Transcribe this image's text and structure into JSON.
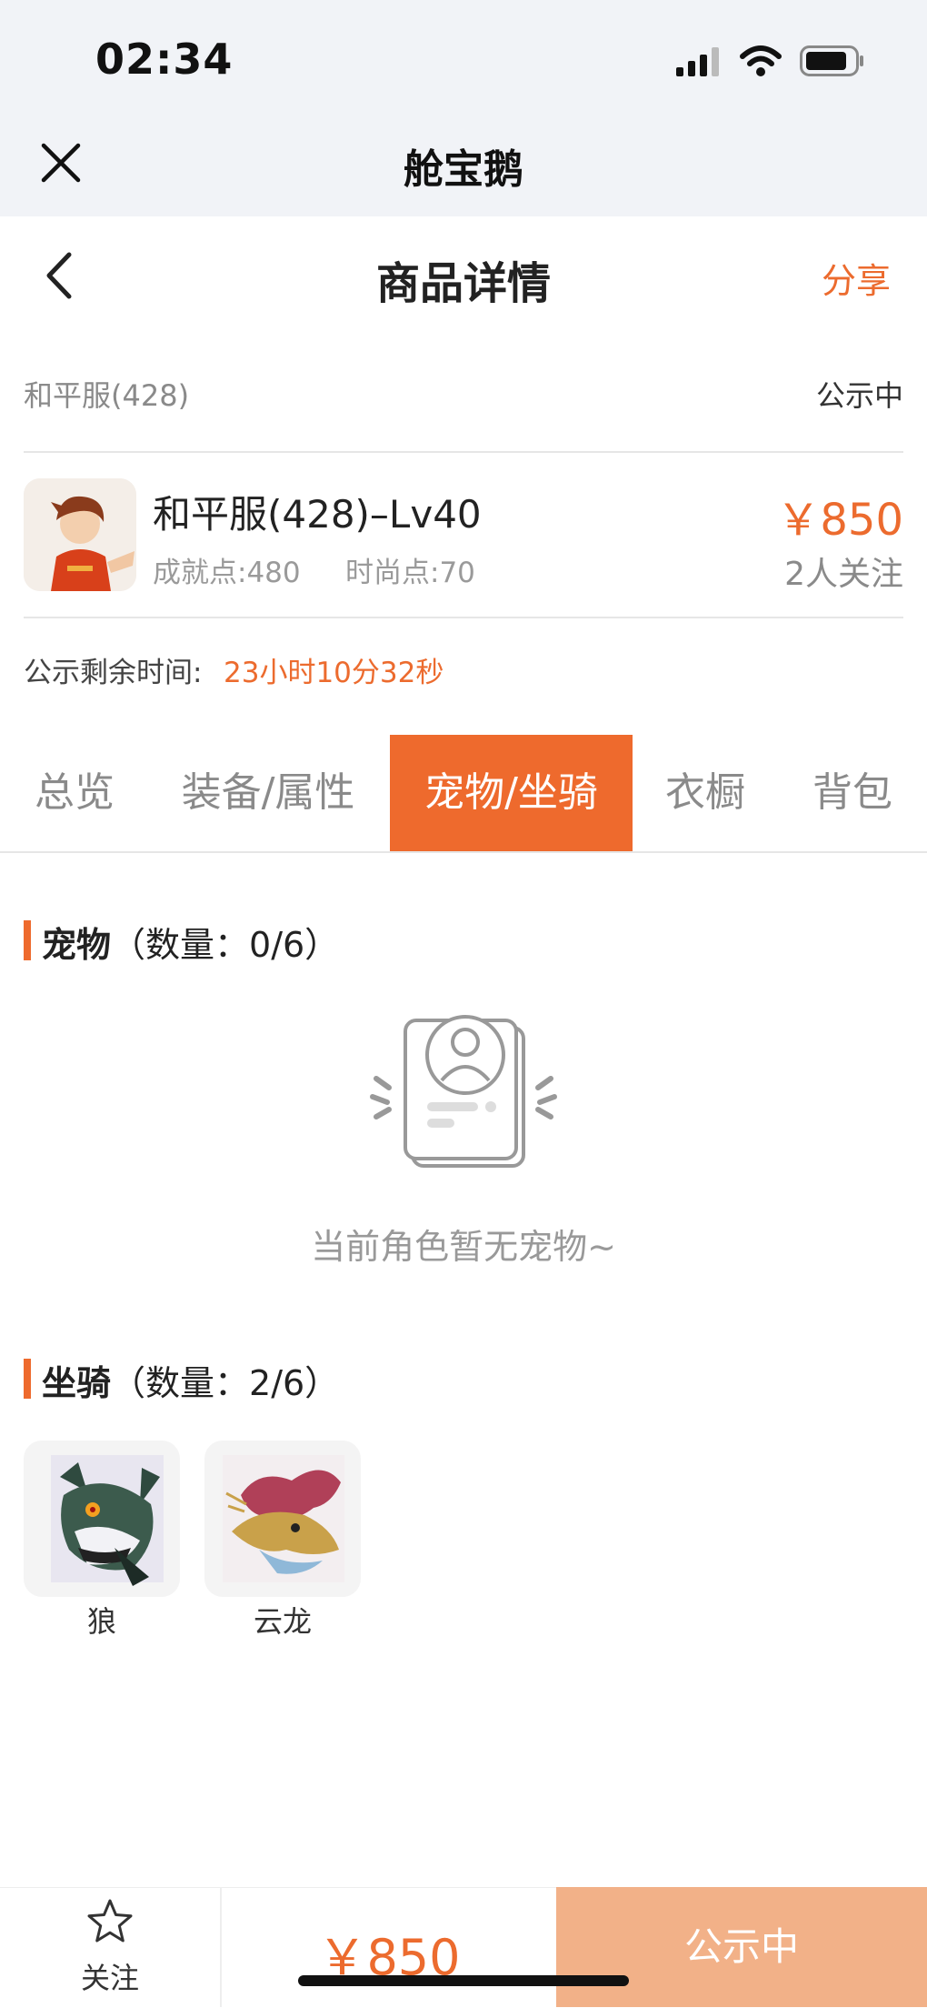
{
  "status_bar": {
    "time": "02:34"
  },
  "miniapp": {
    "title": "舱宝鹅"
  },
  "nav": {
    "title": "商品详情",
    "share": "分享"
  },
  "listing": {
    "server": "和平服(428)",
    "status": "公示中",
    "name": "和平服(428)–Lv40",
    "achievement": "成就点:480",
    "fashion": "时尚点:70",
    "price": "￥850",
    "followers": "2人关注",
    "remain_label": "公示剩余时间:",
    "remain_value": "23小时10分32秒"
  },
  "tabs": [
    {
      "label": "总览"
    },
    {
      "label": "装备/属性"
    },
    {
      "label": "宠物/坐骑",
      "active": true
    },
    {
      "label": "衣橱"
    },
    {
      "label": "背包"
    }
  ],
  "pets": {
    "title": "宠物",
    "count": "（数量：0/6）",
    "empty": "当前角色暂无宠物~"
  },
  "mounts": {
    "title": "坐骑",
    "count": "（数量：2/6）",
    "items": [
      {
        "name": "狼",
        "icon": "wolf-mount-icon"
      },
      {
        "name": "云龙",
        "icon": "cloud-dragon-mount-icon"
      }
    ]
  },
  "bottom_bar": {
    "follow_label": "关注",
    "price": "￥850",
    "status_button": "公示中"
  },
  "colors": {
    "accent": "#ee6a2d",
    "disabled_button": "#f2b188"
  }
}
